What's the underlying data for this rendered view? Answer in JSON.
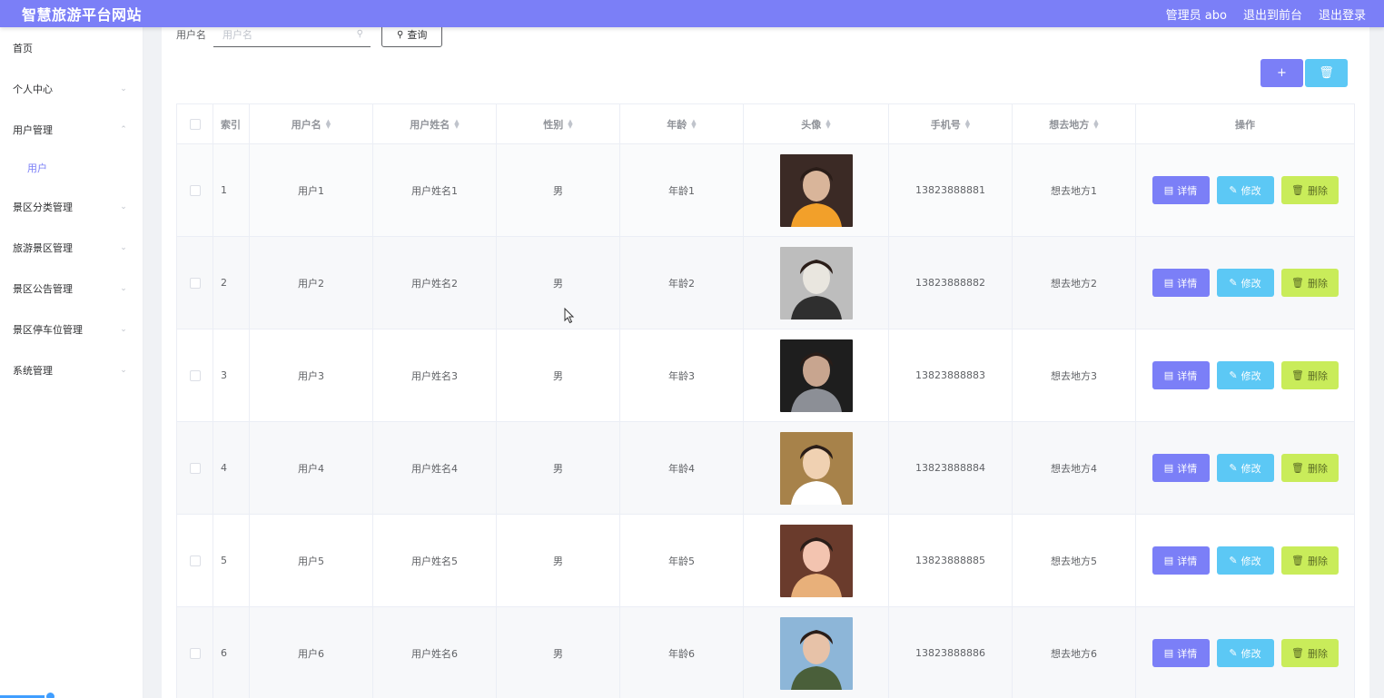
{
  "app": {
    "title": "智慧旅游平台网站",
    "admin_label": "管理员 abo",
    "front_link": "退出到前台",
    "logout_link": "退出登录"
  },
  "sidebar": {
    "items": [
      {
        "label": "首页",
        "arrow": ""
      },
      {
        "label": "个人中心",
        "arrow": "down"
      },
      {
        "label": "用户管理",
        "arrow": "up"
      },
      {
        "label": "景区分类管理",
        "arrow": "down"
      },
      {
        "label": "旅游景区管理",
        "arrow": "down"
      },
      {
        "label": "景区公告管理",
        "arrow": "down"
      },
      {
        "label": "景区停车位管理",
        "arrow": "down"
      },
      {
        "label": "系统管理",
        "arrow": "down"
      }
    ],
    "sub_active": "用户"
  },
  "search": {
    "label": "用户名",
    "placeholder": "用户名",
    "button": "查询"
  },
  "toolbar": {
    "add_icon": "plus-icon",
    "delete_icon": "trash-icon"
  },
  "table": {
    "headers": {
      "index": "索引",
      "username": "用户名",
      "realname": "用户姓名",
      "gender": "性别",
      "age": "年龄",
      "avatar": "头像",
      "phone": "手机号",
      "destination": "想去地方",
      "ops": "操作"
    },
    "ops": {
      "detail": "详情",
      "edit": "修改",
      "delete": "删除"
    },
    "rows": [
      {
        "index": "1",
        "username": "用户1",
        "realname": "用户姓名1",
        "gender": "男",
        "age": "年龄1",
        "phone": "13823888881",
        "destination": "想去地方1"
      },
      {
        "index": "2",
        "username": "用户2",
        "realname": "用户姓名2",
        "gender": "男",
        "age": "年龄2",
        "phone": "13823888882",
        "destination": "想去地方2"
      },
      {
        "index": "3",
        "username": "用户3",
        "realname": "用户姓名3",
        "gender": "男",
        "age": "年龄3",
        "phone": "13823888883",
        "destination": "想去地方3"
      },
      {
        "index": "4",
        "username": "用户4",
        "realname": "用户姓名4",
        "gender": "男",
        "age": "年龄4",
        "phone": "13823888884",
        "destination": "想去地方4"
      },
      {
        "index": "5",
        "username": "用户5",
        "realname": "用户姓名5",
        "gender": "男",
        "age": "年龄5",
        "phone": "13823888885",
        "destination": "想去地方5"
      },
      {
        "index": "6",
        "username": "用户6",
        "realname": "用户姓名6",
        "gender": "男",
        "age": "年龄6",
        "phone": "13823888886",
        "destination": "想去地方6"
      }
    ]
  },
  "colors": {
    "brand": "#7b7ff7",
    "edit": "#5cc8f5",
    "delete": "#c9ec5a"
  }
}
